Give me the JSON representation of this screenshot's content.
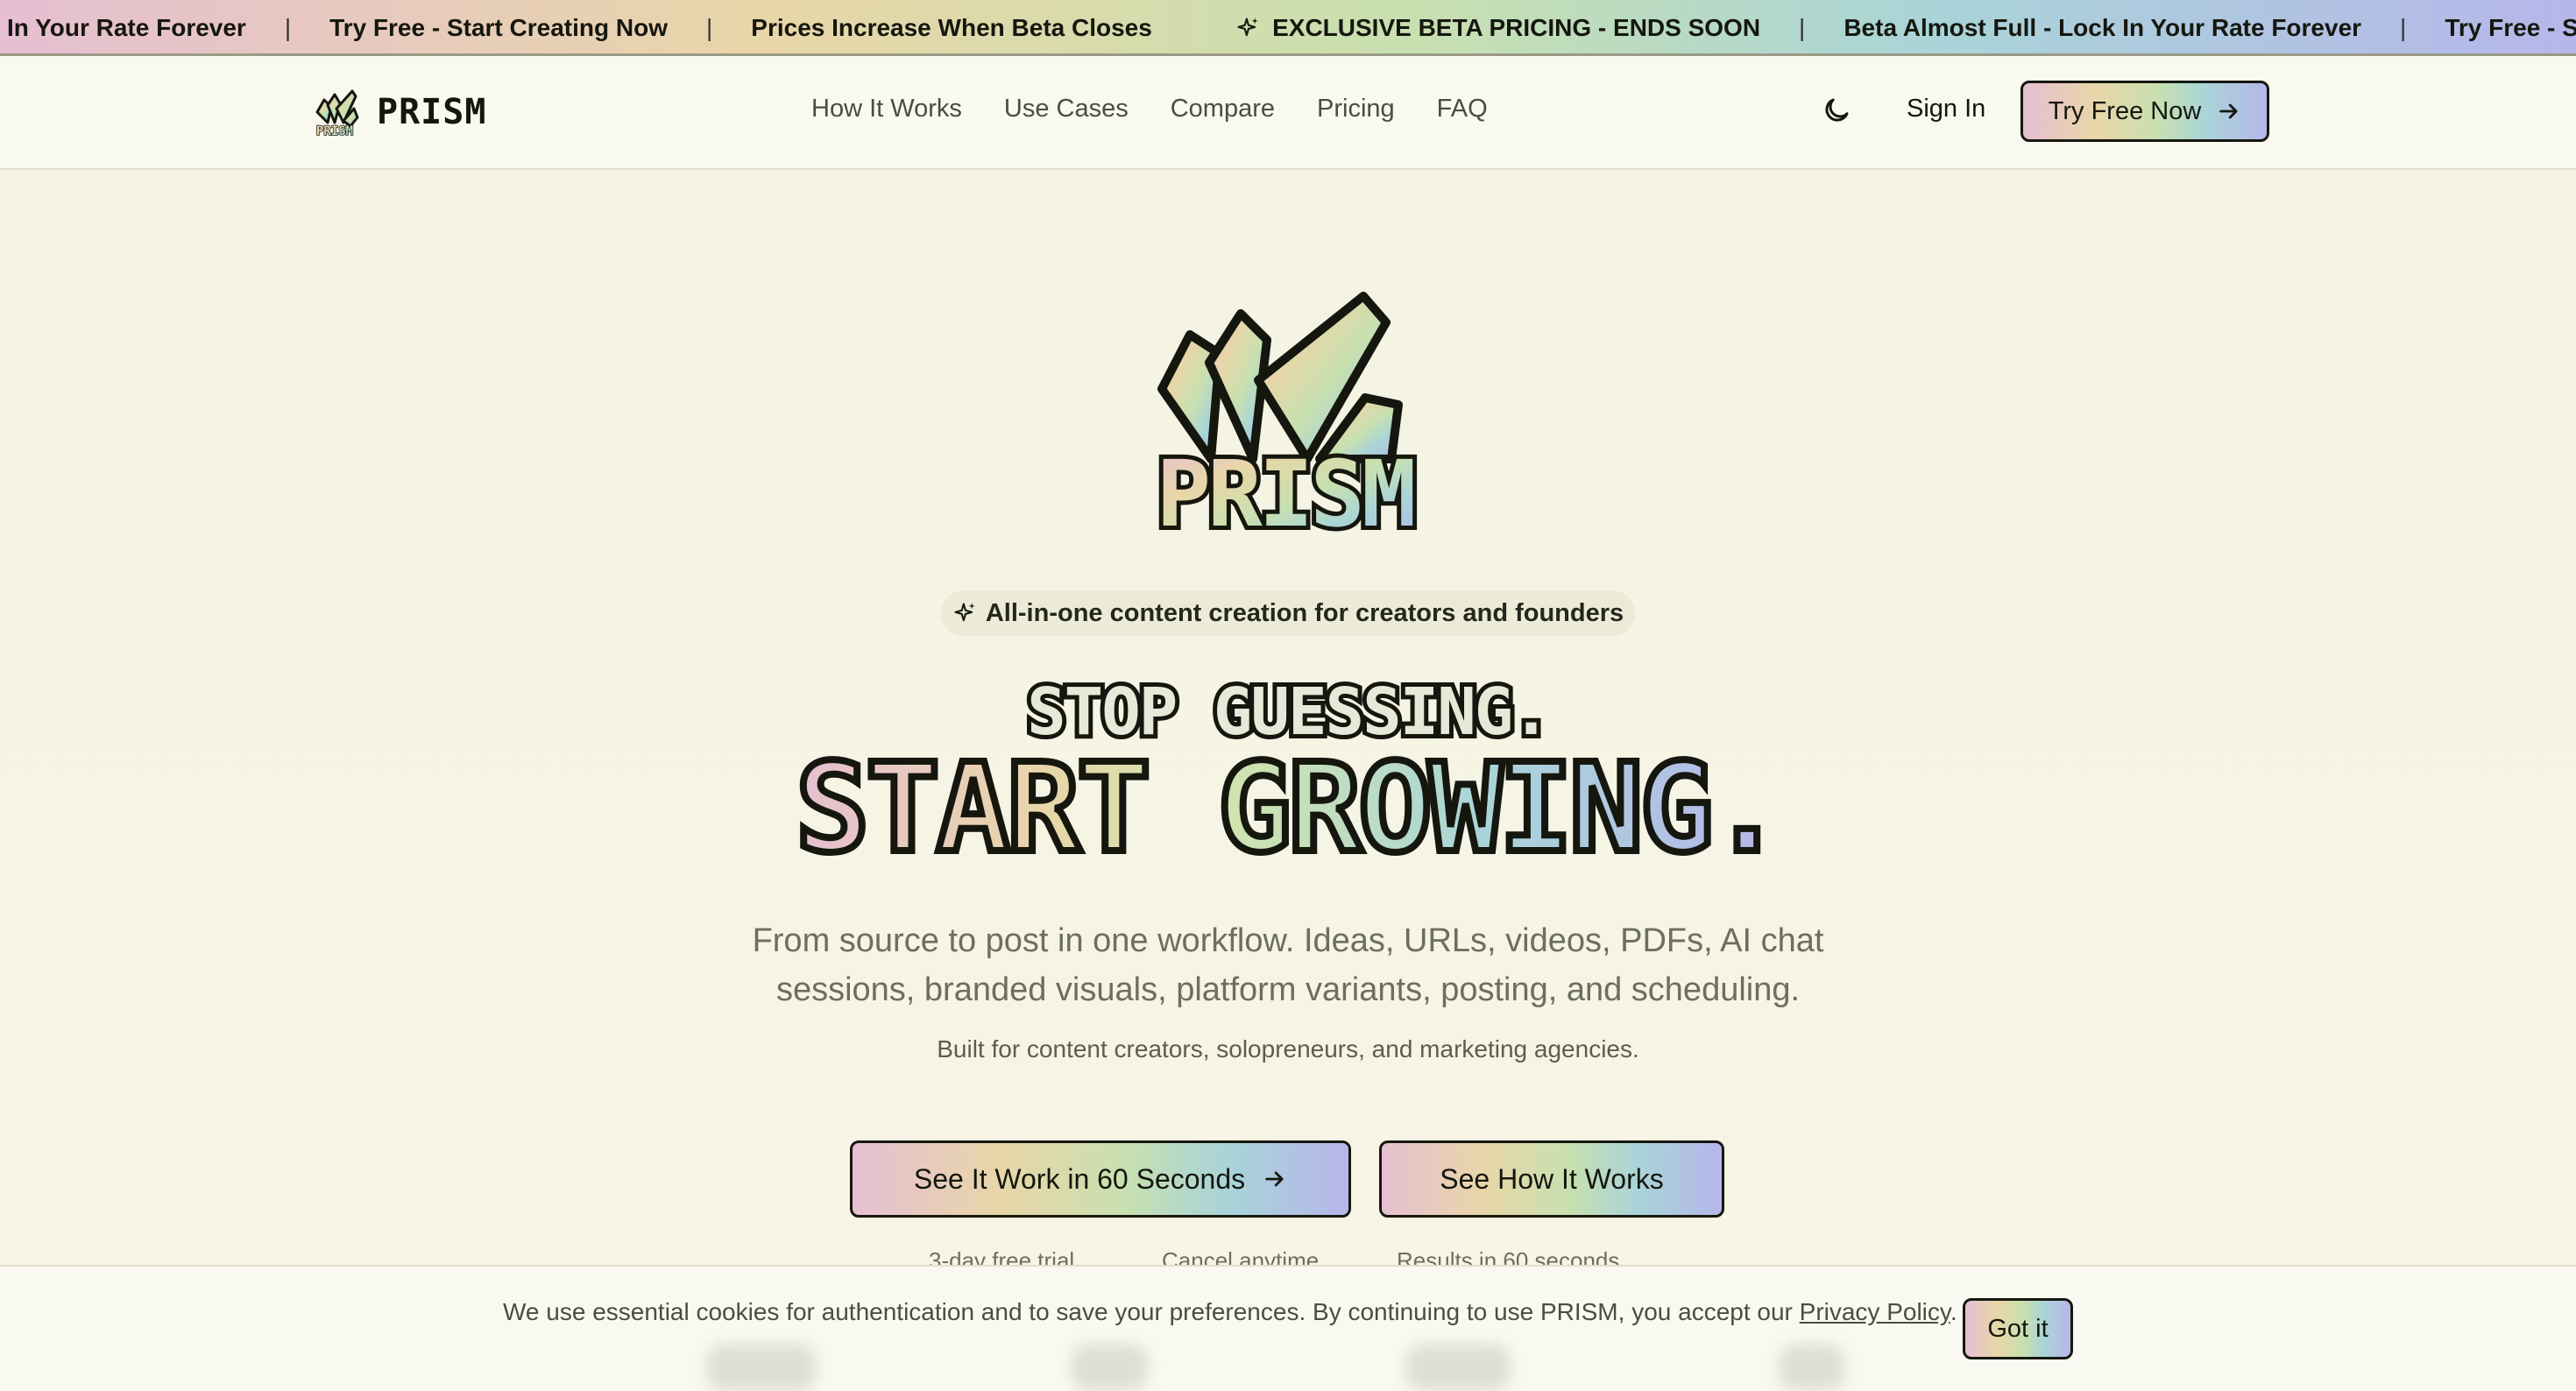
{
  "ticker": {
    "items": [
      {
        "text": "In Your Rate Forever",
        "icon": null
      },
      {
        "text": "Try Free - Start Creating Now",
        "icon": null
      },
      {
        "text": "Prices Increase When Beta Closes",
        "icon": null
      },
      {
        "text": "EXCLUSIVE BETA PRICING - ENDS SOON",
        "icon": "sparkle-icon"
      },
      {
        "text": "Beta Almost Full - Lock In Your Rate Forever",
        "icon": null
      },
      {
        "text": "Try Free - S",
        "icon": null
      }
    ],
    "separator": "|"
  },
  "header": {
    "brand": "PRISM",
    "nav": [
      "How It Works",
      "Use Cases",
      "Compare",
      "Pricing",
      "FAQ"
    ],
    "signin": "Sign In",
    "cta": "Try Free Now"
  },
  "hero": {
    "logo_text": "PRISM",
    "tagline": "All-in-one content creation for creators and founders",
    "headline_1": "STOP GUESSING.",
    "headline_2": "START GROWING.",
    "subtitle": "From source to post in one workflow. Ideas, URLs, videos, PDFs, AI chat sessions, branded visuals, platform variants, posting, and scheduling.",
    "audience": "Built for content creators, solopreneurs, and marketing agencies.",
    "cta_primary": "See It Work in 60 Seconds",
    "cta_secondary": "See How It Works",
    "trust": [
      "3-day free trial",
      "Cancel anytime",
      "Results in 60 seconds"
    ]
  },
  "cookie": {
    "text": "We use essential cookies for authentication and to save your preferences. By continuing to use PRISM, you accept our",
    "link": "Privacy Policy",
    "button": "Got it"
  },
  "colors": {
    "background": "#f7f5e6",
    "ink": "#15170f",
    "holo_pink": "#e6bfd2",
    "holo_yellow": "#e8d6a8",
    "holo_green": "#c8e0b0",
    "holo_cyan": "#a9d4d8",
    "holo_violet": "#b6b6ea"
  }
}
